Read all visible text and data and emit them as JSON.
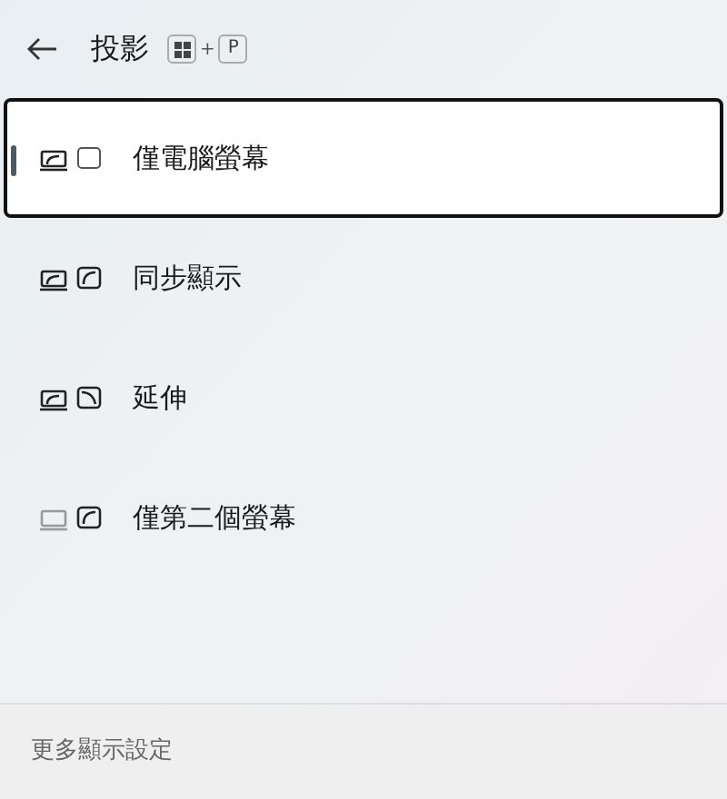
{
  "header": {
    "title": "投影",
    "shortcut": {
      "plus": "+",
      "key": "P"
    }
  },
  "options": [
    {
      "kind": "pc_only",
      "label": "僅電腦螢幕",
      "selected": true
    },
    {
      "kind": "duplicate",
      "label": "同步顯示",
      "selected": false
    },
    {
      "kind": "extend",
      "label": "延伸",
      "selected": false
    },
    {
      "kind": "second_only",
      "label": "僅第二個螢幕",
      "selected": false
    }
  ],
  "footer": {
    "link": "更多顯示設定"
  }
}
